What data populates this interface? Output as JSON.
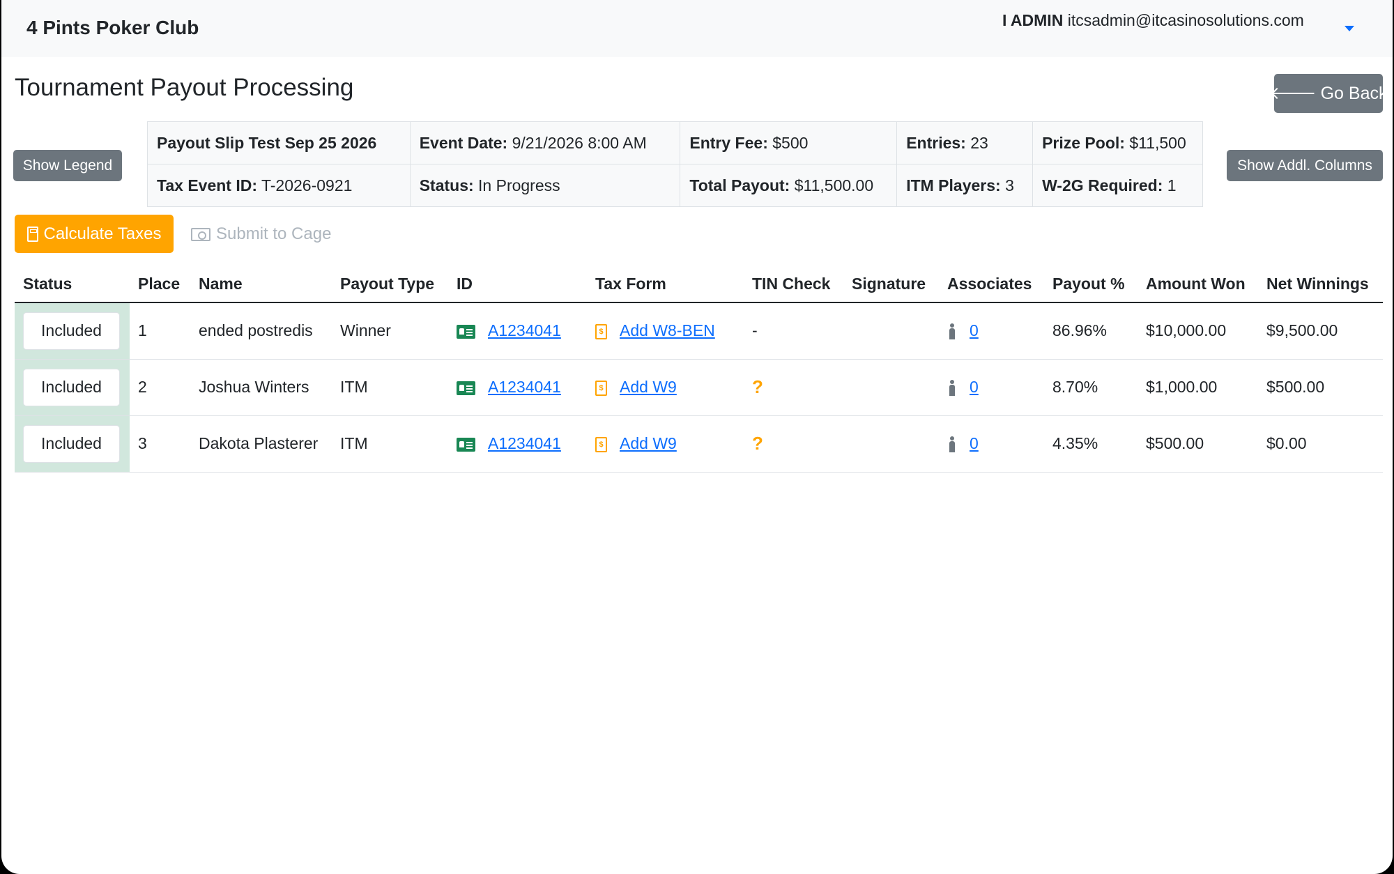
{
  "navbar": {
    "brand": "4 Pints Poker Club",
    "user_name": "I ADMIN",
    "user_email": "itcsadmin@itcasinosolutions.com"
  },
  "page": {
    "title": "Tournament Payout Processing",
    "go_back_label": "Go Back",
    "show_legend_label": "Show Legend",
    "show_addl_label": "Show Addl. Columns",
    "calculate_label": "Calculate Taxes",
    "submit_label": "Submit to Cage"
  },
  "info": {
    "slip_name": "Payout Slip Test Sep 25 2026",
    "event_date_label": "Event Date:",
    "event_date": "9/21/2026 8:00 AM",
    "entry_fee_label": "Entry Fee:",
    "entry_fee": "$500",
    "entries_label": "Entries:",
    "entries": "23",
    "prize_pool_label": "Prize Pool:",
    "prize_pool": "$11,500",
    "tax_event_label": "Tax Event ID:",
    "tax_event_id": "T-2026-0921",
    "status_label": "Status:",
    "status": "In Progress",
    "total_payout_label": "Total Payout:",
    "total_payout": "$11,500.00",
    "itm_players_label": "ITM Players:",
    "itm_players": "3",
    "w2g_label": "W-2G Required:",
    "w2g_required": "1"
  },
  "table": {
    "headers": [
      "Status",
      "Place",
      "Name",
      "Payout Type",
      "ID",
      "Tax Form",
      "TIN Check",
      "Signature",
      "Associates",
      "Payout %",
      "Amount Won",
      "Net Winnings"
    ],
    "rows": [
      {
        "status": "Included",
        "place": "1",
        "name": "ended postredis",
        "payout_type": "Winner",
        "id": "A1234041",
        "tax_form": "Add W8-BEN",
        "tin_check": "-",
        "signature": "",
        "associates": "0",
        "payout_pct": "86.96%",
        "amount_won": "$10,000.00",
        "net_winnings": "$9,500.00"
      },
      {
        "status": "Included",
        "place": "2",
        "name": "Joshua Winters",
        "payout_type": "ITM",
        "id": "A1234041",
        "tax_form": "Add W9",
        "tin_check": "?",
        "signature": "",
        "associates": "0",
        "payout_pct": "8.70%",
        "amount_won": "$1,000.00",
        "net_winnings": "$500.00"
      },
      {
        "status": "Included",
        "place": "3",
        "name": "Dakota Plasterer",
        "payout_type": "ITM",
        "id": "A1234041",
        "tax_form": "Add W9",
        "tin_check": "?",
        "signature": "",
        "associates": "0",
        "payout_pct": "4.35%",
        "amount_won": "$500.00",
        "net_winnings": "$0.00"
      }
    ]
  },
  "colors": {
    "accent_orange": "#ffa400",
    "grey_button": "#6c757d",
    "link_blue": "#0d6efd",
    "included_green": "#d1e7dd",
    "id_green": "#198754"
  }
}
